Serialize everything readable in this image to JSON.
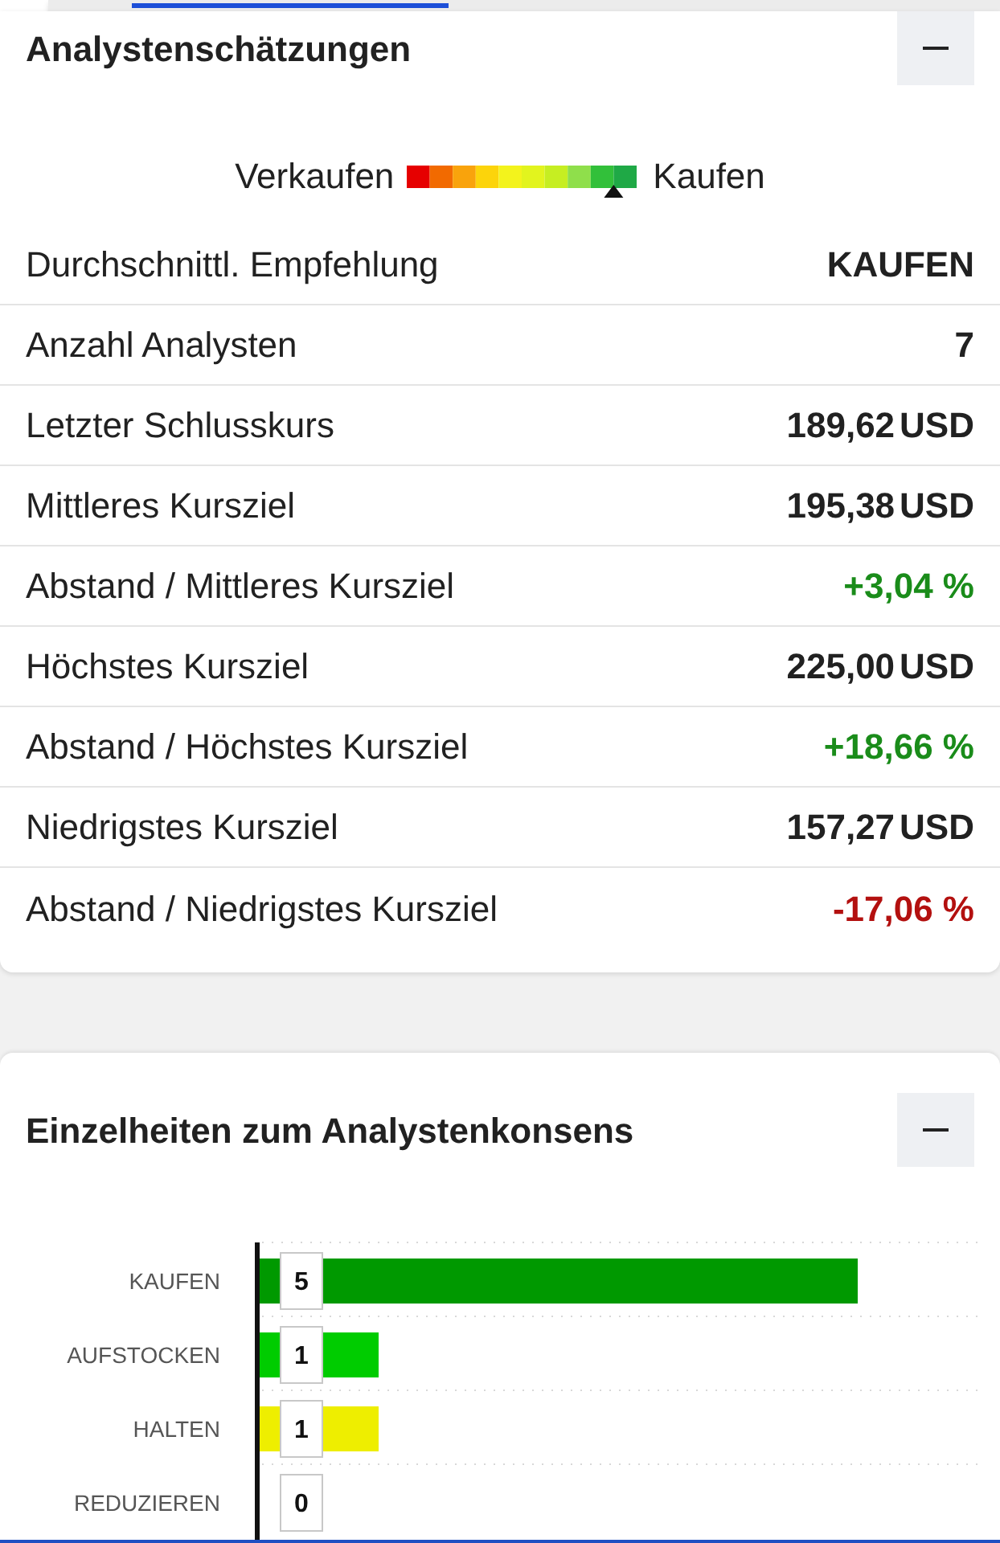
{
  "estimates": {
    "title": "Analystenschätzungen",
    "expanded": true,
    "scale": {
      "low_label": "Verkaufen",
      "high_label": "Kaufen",
      "level": 0.9
    },
    "rows": [
      {
        "label": "Durchschnittl. Empfehlung",
        "value": "KAUFEN"
      },
      {
        "label": "Anzahl Analysten",
        "value": "7"
      },
      {
        "label": "Letzter Schlusskurs",
        "value": "189,62",
        "unit": "USD"
      },
      {
        "label": "Mittleres Kursziel",
        "value": "195,38",
        "unit": "USD"
      },
      {
        "label": "Abstand / Mittleres Kursziel",
        "value": "+3,04 %",
        "color": "#1a8c1a"
      },
      {
        "label": "Höchstes Kursziel",
        "value": "225,00",
        "unit": "USD"
      },
      {
        "label": "Abstand / Höchstes Kursziel",
        "value": "+18,66 %",
        "color": "#1a8c1a"
      },
      {
        "label": "Niedrigstes Kursziel",
        "value": "157,27",
        "unit": "USD"
      },
      {
        "label": "Abstand / Niedrigstes Kursziel",
        "value": "-17,06 %",
        "color": "#b3100f"
      }
    ]
  },
  "consensus": {
    "title": "Einzelheiten zum Analystenkonsens",
    "expanded": true,
    "chart_data": {
      "type": "bar",
      "orientation": "horizontal",
      "categories": [
        "KAUFEN",
        "AUFSTOCKEN",
        "HALTEN",
        "REDUZIEREN"
      ],
      "values": [
        5,
        1,
        1,
        0
      ],
      "data_labels": true,
      "colors": [
        "#009900",
        "#00cc00",
        "#eeee00",
        null
      ]
    }
  }
}
